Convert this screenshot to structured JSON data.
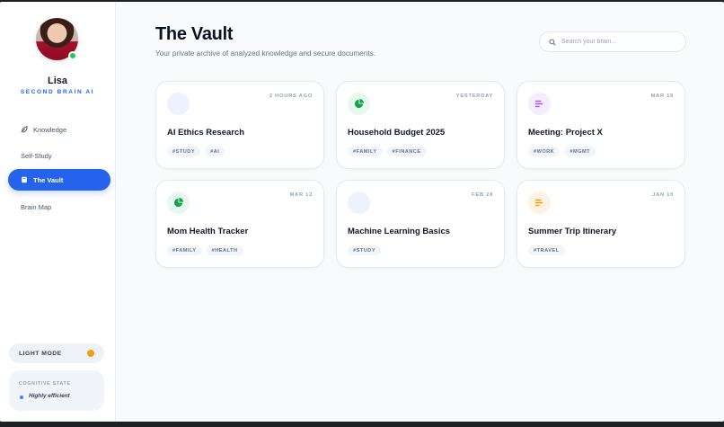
{
  "sidebar": {
    "user_name": "Lisa",
    "user_subtitle": "SECOND BRAIN AI",
    "nav": [
      {
        "label": "Knowledge",
        "icon": "feather-icon"
      },
      {
        "label": "Self-Study",
        "icon": ""
      },
      {
        "label": "The Vault",
        "icon": "book-icon",
        "active": true
      },
      {
        "label": "Brain Map",
        "icon": ""
      }
    ],
    "mode_label": "LIGHT MODE",
    "cognitive": {
      "title": "COGNITIVE STATE",
      "value": "Highly efficient"
    }
  },
  "header": {
    "title": "The Vault",
    "subtitle": "Your private archive of analyzed knowledge and secure documents.",
    "search_placeholder": "Search your brain..."
  },
  "cards": [
    {
      "title": "AI Ethics Research",
      "date": "2 HOURS AGO",
      "tags": [
        "#STUDY",
        "#AI"
      ],
      "icon": "blank-icon"
    },
    {
      "title": "Household Budget 2025",
      "date": "YESTERDAY",
      "tags": [
        "#FAMILY",
        "#FINANCE"
      ],
      "icon": "pie-chart-icon"
    },
    {
      "title": "Meeting: Project X",
      "date": "MAR 15",
      "tags": [
        "#WORK",
        "#MGMT"
      ],
      "icon": "list-icon"
    },
    {
      "title": "Mom Health Tracker",
      "date": "MAR 12",
      "tags": [
        "#FAMILY",
        "#HEALTH"
      ],
      "icon": "pie-chart-icon"
    },
    {
      "title": "Machine Learning Basics",
      "date": "FEB 28",
      "tags": [
        "#STUDY"
      ],
      "icon": "blank-icon"
    },
    {
      "title": "Summer Trip Itinerary",
      "date": "JAN 10",
      "tags": [
        "#TRAVEL"
      ],
      "icon": "list-icon"
    }
  ],
  "colors": {
    "accent": "#2563eb",
    "online": "#22c55e",
    "pie_icon": "#16a34a",
    "list_icon_purple": "#a855f7",
    "list_icon_orange": "#f59e0b"
  }
}
